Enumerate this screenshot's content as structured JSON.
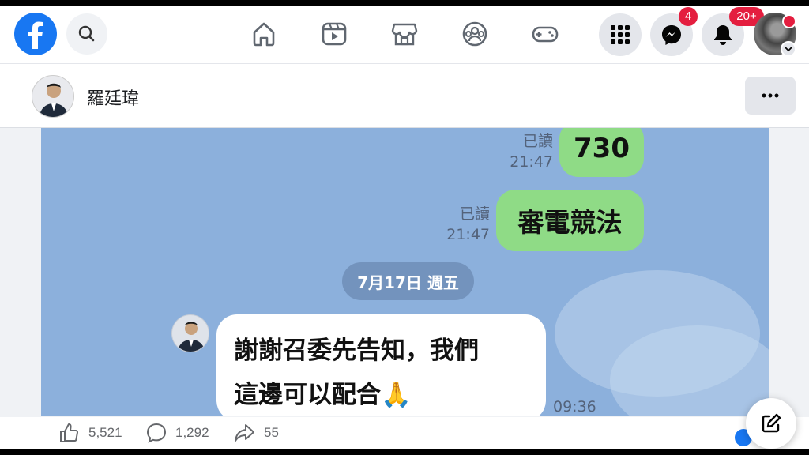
{
  "navbar": {
    "messenger_badge": "4",
    "notifications_badge": "20+"
  },
  "profile": {
    "name": "羅廷瑋"
  },
  "post_image": {
    "msg1": {
      "read": "已讀",
      "time": "21:47",
      "text": "730"
    },
    "msg2": {
      "read": "已讀",
      "time": "21:47",
      "text": "審電競法"
    },
    "date_separator": "7月17日 週五",
    "reply": {
      "line1": "謝謝召委先告知，我們",
      "line2": "這邊可以配合🙏",
      "time": "09:36"
    }
  },
  "actions": {
    "likes": "5,521",
    "comments": "1,292",
    "shares": "55"
  },
  "colors": {
    "brand": "#1877f2",
    "badge": "#e41e3f",
    "chat_bg": "#8cb0dc",
    "bubble_green": "#8fdb86"
  }
}
